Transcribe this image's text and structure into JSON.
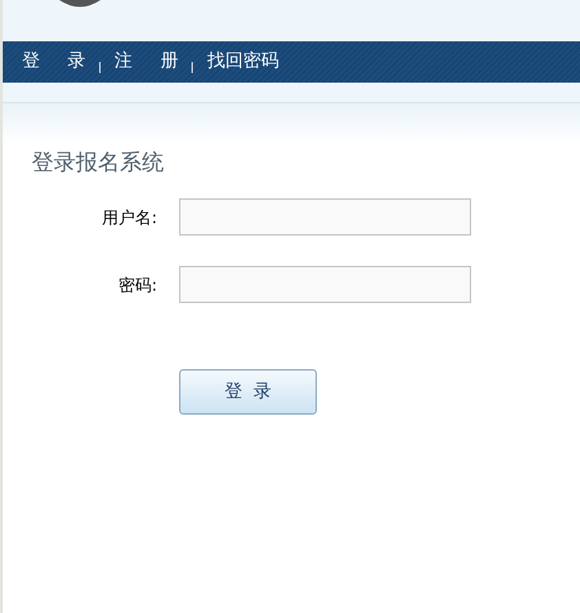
{
  "nav": [
    {
      "label": "登 录"
    },
    {
      "label": "注 册"
    },
    {
      "label": "找回密码"
    }
  ],
  "title": "登录报名系统",
  "fields": [
    {
      "label": "用户名:"
    },
    {
      "label": "密码:"
    }
  ],
  "button": "登 录"
}
